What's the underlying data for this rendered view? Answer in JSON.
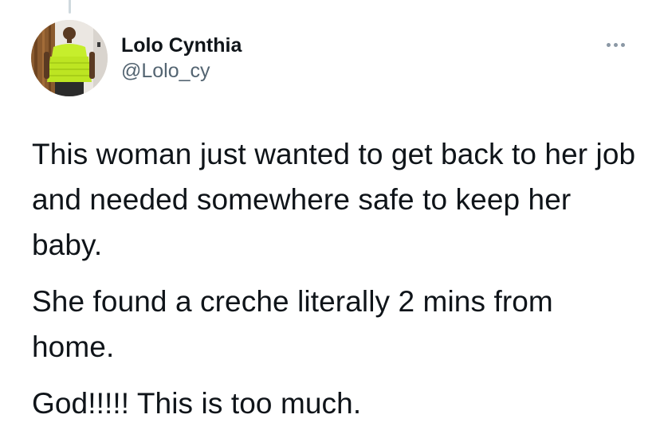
{
  "author": {
    "name": "Lolo Cynthia",
    "handle": "@Lolo_cy"
  },
  "menu_icon": "more-horizontal-icon",
  "tweet": {
    "paragraphs": [
      "This woman just wanted to get back to her job and needed somewhere safe to keep her baby.",
      "She found a creche literally 2 mins from home.",
      "God!!!!! This is too much."
    ]
  },
  "colors": {
    "text_primary": "#0f1419",
    "text_secondary": "#536471",
    "icon_muted": "#8b98a5",
    "avatar_top": "#c9f03a"
  }
}
